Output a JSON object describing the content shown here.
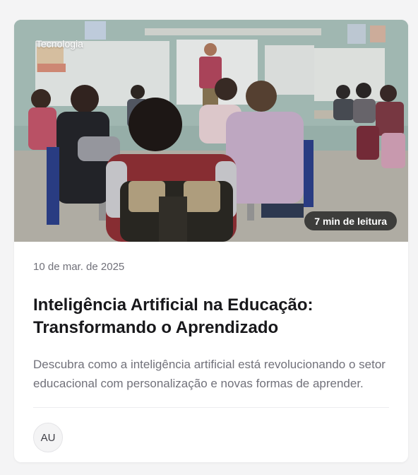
{
  "card": {
    "category": "Tecnologia",
    "read_time": "7 min de leitura",
    "date": "10 de mar. de 2025",
    "title": "Inteligência Artificial na Educação: Transformando o Aprendizado",
    "excerpt": "Descubra como a inteligência artificial está revolucionando o setor educacional com personalização e novas formas de aprender.",
    "author_initials": "AU"
  },
  "colors": {
    "page_background": "#f4f4f5",
    "card_background": "#ffffff",
    "title_text": "#18181b",
    "muted_text": "#71717a"
  }
}
